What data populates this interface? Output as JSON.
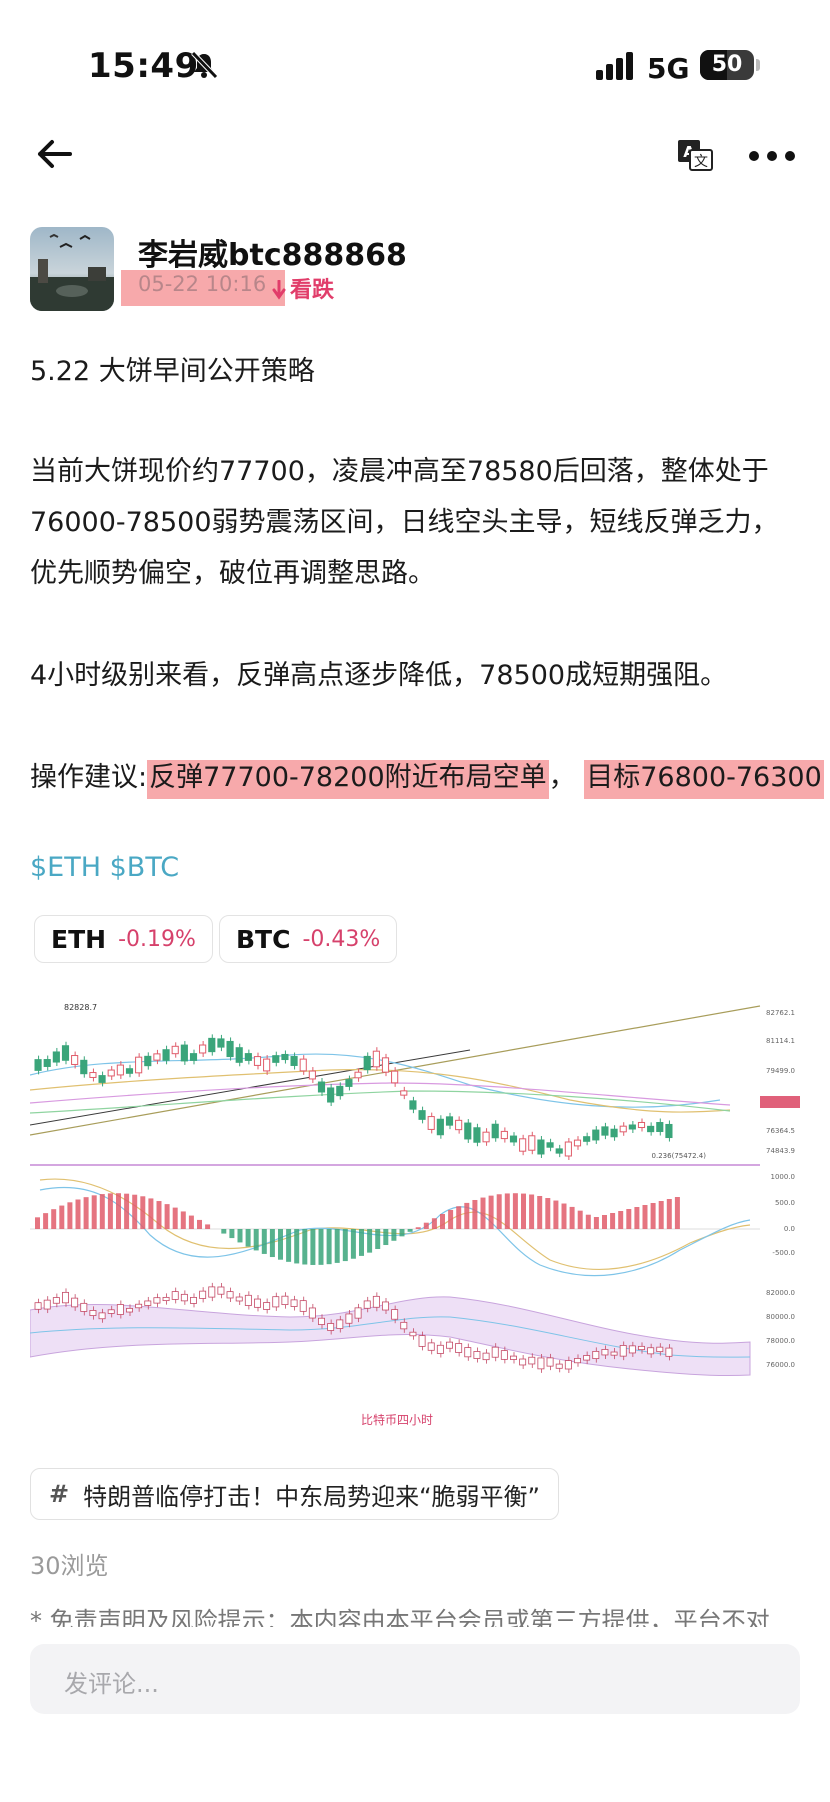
{
  "status_bar": {
    "time": "15:49",
    "network": "5G",
    "battery": "50"
  },
  "author": {
    "name": "李岩威btc888868",
    "datetime": "05-22 10:16",
    "sentiment": "看跌"
  },
  "post": {
    "title": "5.22 大饼早间公开策略",
    "p1_l1": "当前大饼现价约77700，凌晨冲高至78580后回落，整体处于",
    "p1_l2": "76000-78500弱势震荡区间，日线空头主导，短线反弹乏力，",
    "p1_l3": "优先顺势偏空，破位再调整思路。",
    "p2": "4小时级别来看，反弹高点逐步降低，78500成短期强阻。",
    "advice_prefix": "操作建议:",
    "advice_hl1": "反弹77700-78200附近布局空单",
    "advice_sep": "，",
    "advice_hl2": "目标76800-76300"
  },
  "tags": "$ETH $BTC",
  "tickers": [
    {
      "symbol": "ETH",
      "change": "-0.19%"
    },
    {
      "symbol": "BTC",
      "change": "-0.43%"
    }
  ],
  "chart_image": {
    "caption": "比特币四小时",
    "price_labels": [
      "82762.1",
      "81114.1",
      "79499.0",
      "77739.5",
      "76364.5",
      "74843.9"
    ],
    "macd_labels": [
      "1000.0",
      "500.0",
      "0.0",
      "-500.0"
    ],
    "lower_labels": [
      "82000.0",
      "80000.0",
      "78000.0",
      "76000.0"
    ],
    "high_marker": "82828.7",
    "fib_label": "0.236(75472.4)",
    "colors": {
      "up": "#e05c6a",
      "down": "#3aa57a"
    }
  },
  "topic": {
    "hash": "#",
    "text": "特朗普临停打击！中东局势迎来“脆弱平衡”"
  },
  "views": "30浏览",
  "disclaimer": "* 免责声明及风险提示：本内容由本平台会员或第三方提供，平台不对",
  "comment_placeholder": "发评论..."
}
